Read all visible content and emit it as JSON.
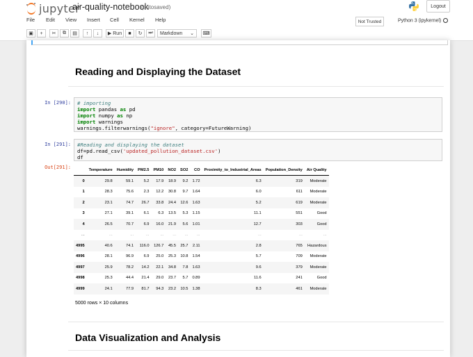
{
  "header": {
    "logo_text": "jupyter",
    "notebook_name": "air-quality-notebook",
    "autosave": "(autosaved)",
    "logout_label": "Logout"
  },
  "menu": [
    "File",
    "Edit",
    "View",
    "Insert",
    "Cell",
    "Kernel",
    "Help"
  ],
  "status": {
    "trusted": "Not Trusted",
    "kernel": "Python 3 (ipykernel)"
  },
  "toolbar": {
    "run_label": "Run",
    "cell_type": "Markdown"
  },
  "headings": {
    "reading": "Reading and Displaying the Dataset",
    "visualization": "Data Visualization and Analysis"
  },
  "cells": {
    "c1_prompt": "In [290]:",
    "c2_prompt": "In [291]:",
    "out_prompt": "Out[291]:"
  },
  "dataframe": {
    "columns": [
      "",
      "Temperature",
      "Humidity",
      "PM2.5",
      "PM10",
      "NO2",
      "SO2",
      "CO",
      "Proximity_to_Industrial_Areas",
      "Population_Density",
      "Air Quality"
    ],
    "rows": [
      [
        "0",
        "29.8",
        "59.1",
        "5.2",
        "17.9",
        "18.9",
        "9.2",
        "1.72",
        "6.3",
        "319",
        "Moderate"
      ],
      [
        "1",
        "28.3",
        "75.6",
        "2.3",
        "12.2",
        "30.8",
        "9.7",
        "1.64",
        "6.0",
        "611",
        "Moderate"
      ],
      [
        "2",
        "23.1",
        "74.7",
        "26.7",
        "33.8",
        "24.4",
        "12.6",
        "1.63",
        "5.2",
        "619",
        "Moderate"
      ],
      [
        "3",
        "27.1",
        "39.1",
        "6.1",
        "6.3",
        "13.5",
        "5.3",
        "1.15",
        "11.1",
        "551",
        "Good"
      ],
      [
        "4",
        "26.5",
        "70.7",
        "6.9",
        "16.0",
        "21.9",
        "5.6",
        "1.01",
        "12.7",
        "303",
        "Good"
      ],
      [
        "...",
        "...",
        "...",
        "...",
        "...",
        "...",
        "...",
        "...",
        "...",
        "...",
        "..."
      ],
      [
        "4995",
        "40.6",
        "74.1",
        "116.0",
        "126.7",
        "45.5",
        "25.7",
        "2.11",
        "2.8",
        "765",
        "Hazardous"
      ],
      [
        "4996",
        "28.1",
        "96.9",
        "6.9",
        "25.0",
        "25.3",
        "10.8",
        "1.54",
        "5.7",
        "709",
        "Moderate"
      ],
      [
        "4997",
        "25.9",
        "78.2",
        "14.2",
        "22.1",
        "34.8",
        "7.8",
        "1.63",
        "9.6",
        "379",
        "Moderate"
      ],
      [
        "4998",
        "25.3",
        "44.4",
        "21.4",
        "29.0",
        "23.7",
        "5.7",
        "0.89",
        "11.6",
        "241",
        "Good"
      ],
      [
        "4999",
        "24.1",
        "77.9",
        "81.7",
        "94.3",
        "23.2",
        "10.5",
        "1.38",
        "8.3",
        "461",
        "Moderate"
      ]
    ],
    "shape": "5000 rows × 10 columns"
  }
}
